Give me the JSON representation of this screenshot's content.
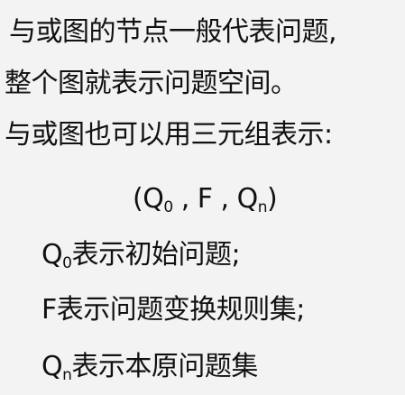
{
  "lines": {
    "line1": "与或图的节点一般代表问题,",
    "line2": "整个图就表示问题空间。",
    "line3": "与或图也可以用三元组表示:",
    "tuple": {
      "open": "(Q",
      "sub0": "0",
      "mid": " , F , Q",
      "subn": "n",
      "close": ")"
    },
    "item1": {
      "symbol": "Q",
      "sub": "0",
      "text": "表示初始问题;"
    },
    "item2": {
      "text": "F表示问题变换规则集;"
    },
    "item3": {
      "symbol": "Q",
      "sub": "n",
      "text": "表示本原问题集"
    }
  }
}
